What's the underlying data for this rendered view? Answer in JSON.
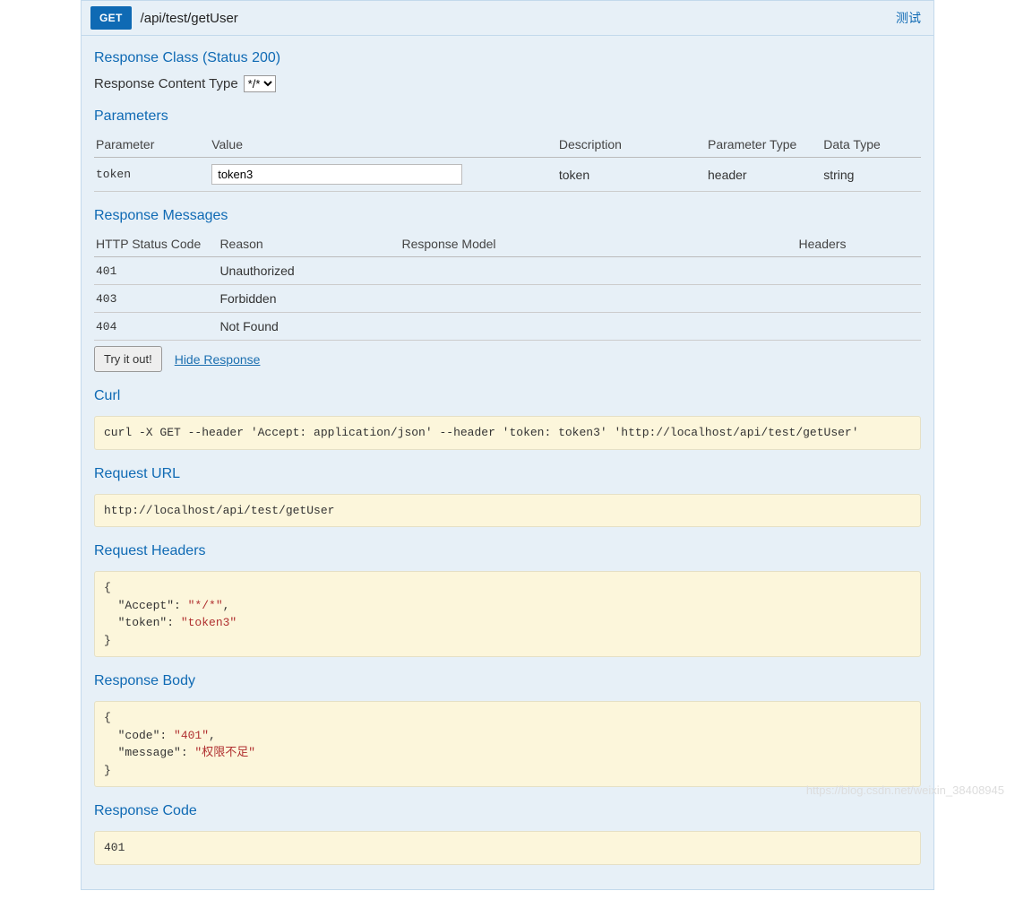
{
  "header": {
    "method": "GET",
    "path": "/api/test/getUser",
    "test_link": "测试"
  },
  "sections": {
    "response_class": "Response Class (Status 200)",
    "content_type_label": "Response Content Type",
    "parameters": "Parameters",
    "response_messages": "Response Messages",
    "curl": "Curl",
    "request_url": "Request URL",
    "request_headers": "Request Headers",
    "response_body": "Response Body",
    "response_code": "Response Code"
  },
  "content_type_options": [
    "*/*"
  ],
  "param_headers": {
    "parameter": "Parameter",
    "value": "Value",
    "description": "Description",
    "parameter_type": "Parameter Type",
    "data_type": "Data Type"
  },
  "params": [
    {
      "name": "token",
      "value": "token3",
      "description": "token",
      "param_type": "header",
      "data_type": "string"
    }
  ],
  "msg_headers": {
    "code": "HTTP Status Code",
    "reason": "Reason",
    "model": "Response Model",
    "headers": "Headers"
  },
  "messages": [
    {
      "code": "401",
      "reason": "Unauthorized",
      "model": "",
      "headers": ""
    },
    {
      "code": "403",
      "reason": "Forbidden",
      "model": "",
      "headers": ""
    },
    {
      "code": "404",
      "reason": "Not Found",
      "model": "",
      "headers": ""
    }
  ],
  "actions": {
    "try_it_out": "Try it out!",
    "hide_response": "Hide Response"
  },
  "curl_command": "curl -X GET --header 'Accept: application/json' --header 'token: token3' 'http://localhost/api/test/getUser'",
  "request_url": "http://localhost/api/test/getUser",
  "request_headers_text": "{\n  \"Accept\": \"*/*\",\n  \"token\": \"token3\"\n}",
  "response_body_text": "{\n  \"code\": \"401\",\n  \"message\": \"权限不足\"\n}",
  "response_code": "401",
  "watermark": "https://blog.csdn.net/weixin_38408945"
}
